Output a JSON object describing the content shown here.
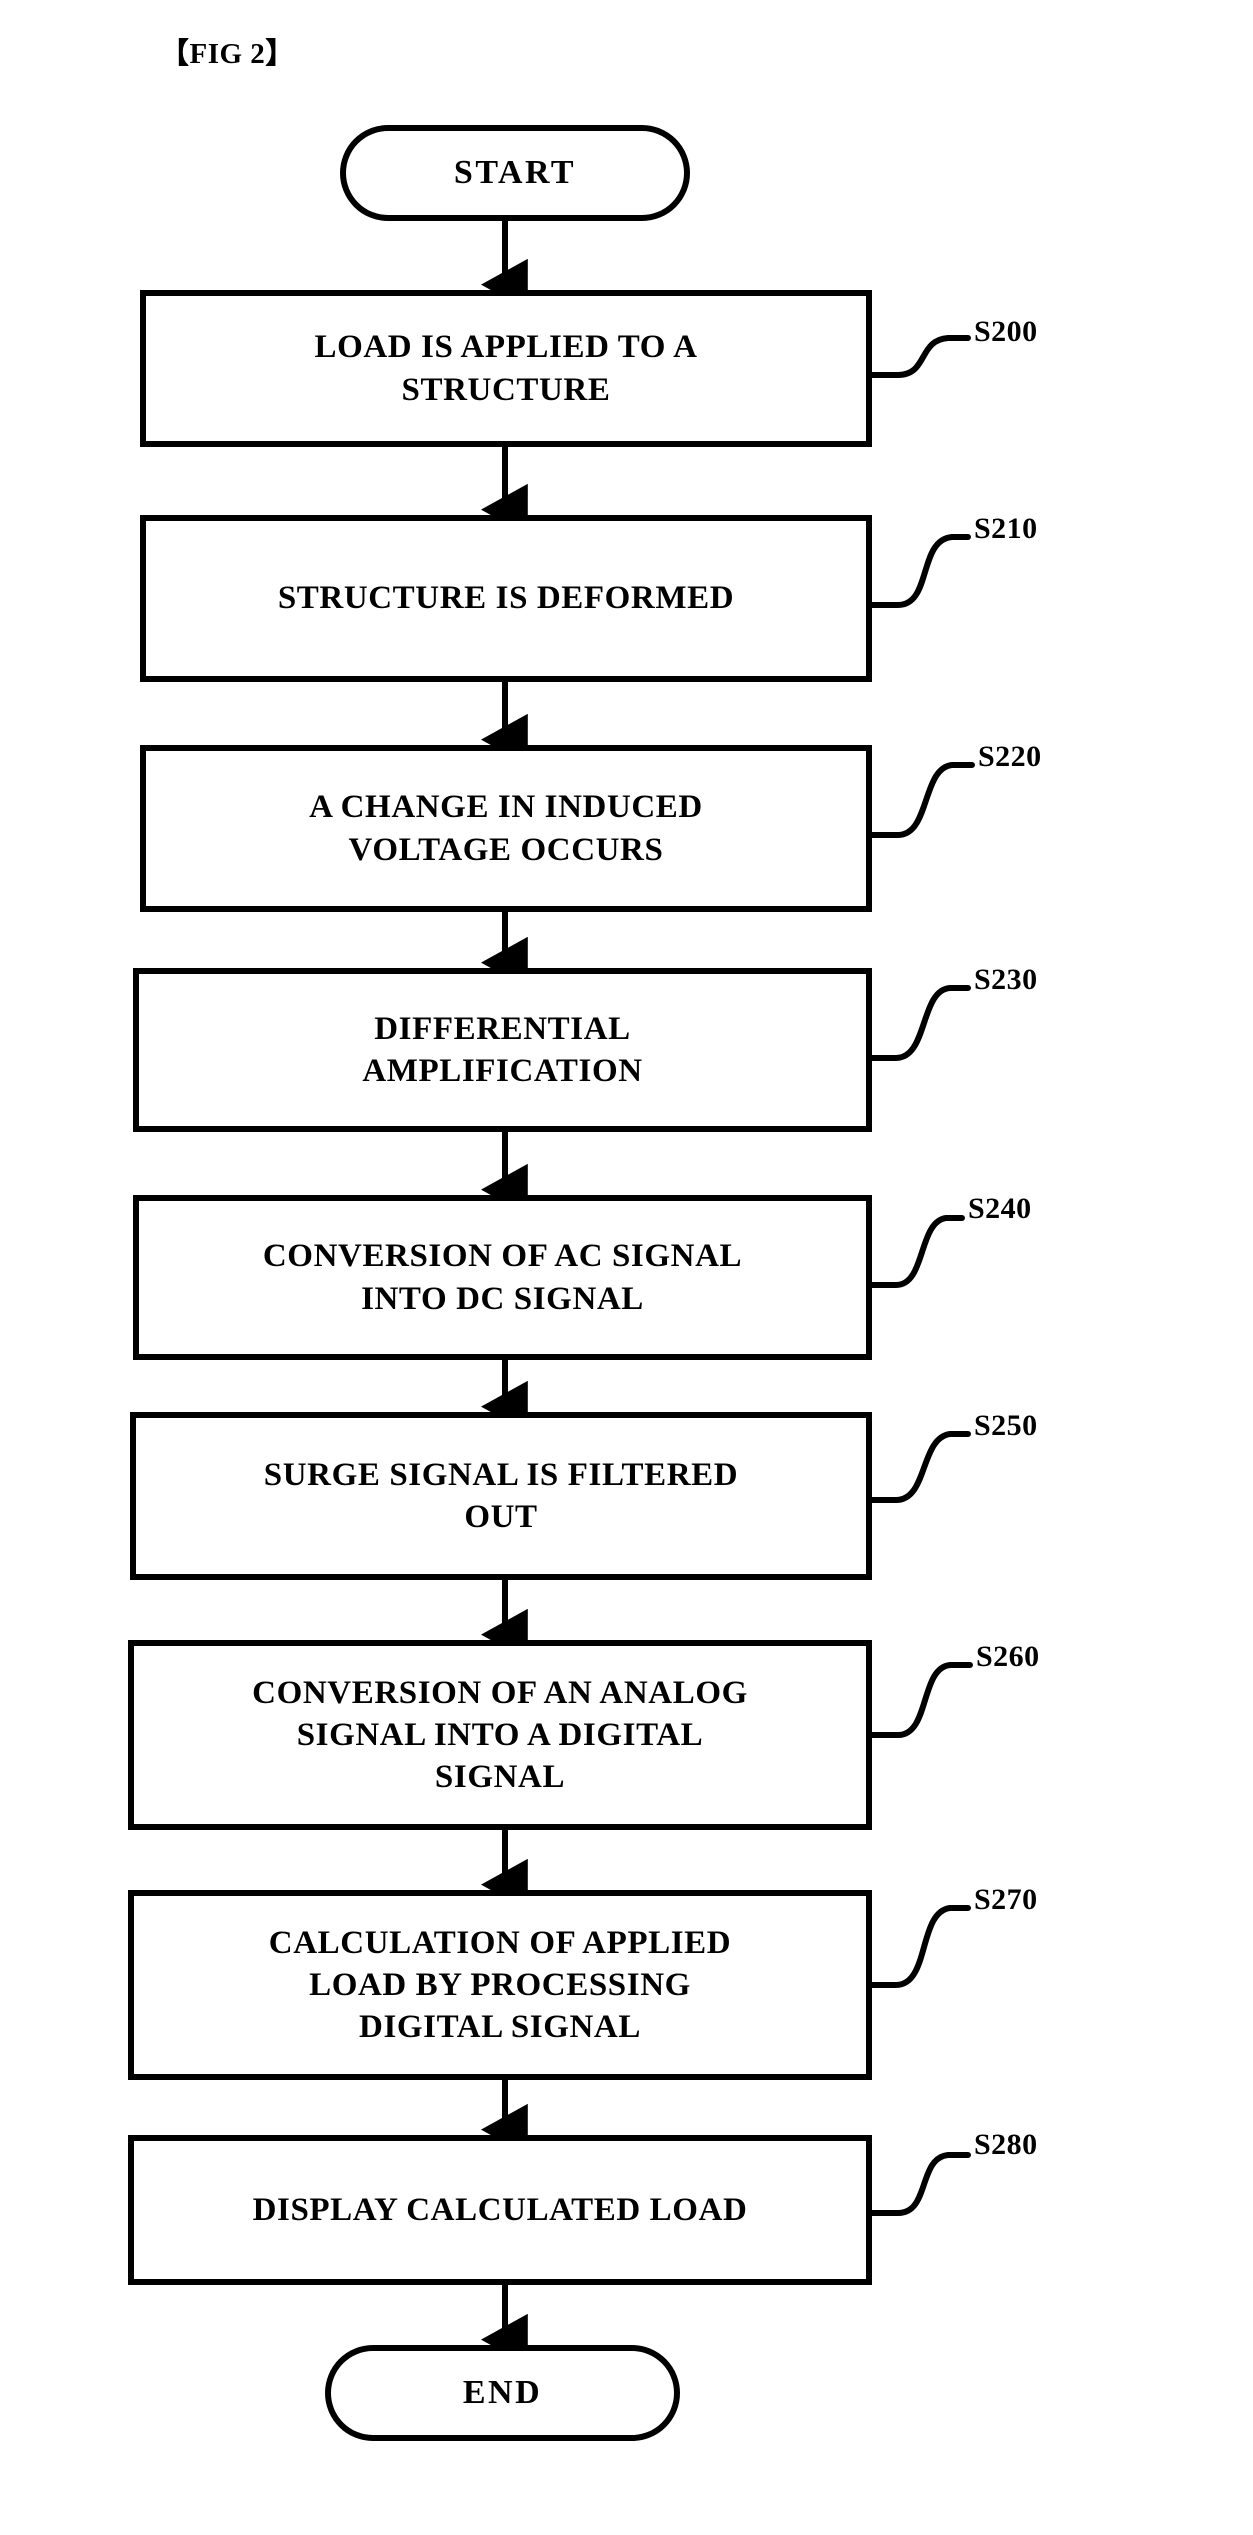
{
  "figure": {
    "title": "【FIG 2】",
    "colors": {
      "ink": "#000000",
      "background": "#ffffff"
    }
  },
  "flowchart": {
    "type": "flowchart",
    "orientation": "top-to-bottom",
    "start": {
      "shape": "terminator",
      "label": "START"
    },
    "end": {
      "shape": "terminator",
      "label": "END"
    },
    "steps": [
      {
        "ref": "S200",
        "shape": "process",
        "label": "LOAD IS APPLIED TO A\nSTRUCTURE",
        "lines": 2
      },
      {
        "ref": "S210",
        "shape": "process",
        "label": "STRUCTURE IS DEFORMED",
        "lines": 1
      },
      {
        "ref": "S220",
        "shape": "process",
        "label": "A CHANGE IN INDUCED\nVOLTAGE OCCURS",
        "lines": 2
      },
      {
        "ref": "S230",
        "shape": "process",
        "label": "DIFFERENTIAL\nAMPLIFICATION",
        "lines": 2
      },
      {
        "ref": "S240",
        "shape": "process",
        "label": "CONVERSION OF AC SIGNAL\nINTO DC SIGNAL",
        "lines": 2
      },
      {
        "ref": "S250",
        "shape": "process",
        "label": "SURGE SIGNAL IS FILTERED\nOUT",
        "lines": 2
      },
      {
        "ref": "S260",
        "shape": "process",
        "label": "CONVERSION OF AN ANALOG\nSIGNAL INTO A DIGITAL\nSIGNAL",
        "lines": 3
      },
      {
        "ref": "S270",
        "shape": "process",
        "label": "CALCULATION OF APPLIED\nLOAD BY PROCESSING\nDIGITAL SIGNAL",
        "lines": 3
      },
      {
        "ref": "S280",
        "shape": "process",
        "label": "DISPLAY CALCULATED LOAD",
        "lines": 1
      }
    ]
  }
}
